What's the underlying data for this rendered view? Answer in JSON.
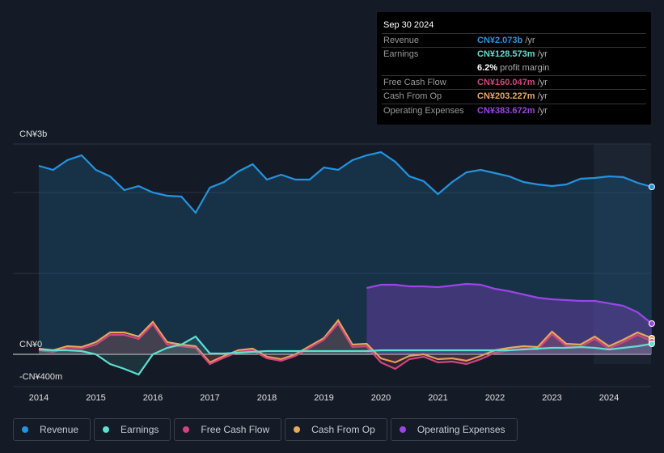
{
  "tooltip": {
    "date": "Sep 30 2024",
    "rows": [
      {
        "label": "Revenue",
        "value": "CN¥2.073b",
        "unit": " /yr",
        "color": "#2394df"
      },
      {
        "label": "Earnings",
        "value": "CN¥128.573m",
        "unit": " /yr",
        "color": "#5ce0d0"
      },
      {
        "label": "",
        "value": "6.2%",
        "unit": " profit margin",
        "color": "#ffffff"
      },
      {
        "label": "Free Cash Flow",
        "value": "CN¥160.047m",
        "unit": " /yr",
        "color": "#d0457f"
      },
      {
        "label": "Cash From Op",
        "value": "CN¥203.227m",
        "unit": " /yr",
        "color": "#e8a95a"
      },
      {
        "label": "Operating Expenses",
        "value": "CN¥383.672m",
        "unit": " /yr",
        "color": "#9b45e4"
      }
    ]
  },
  "chart_data": {
    "type": "area",
    "y_labels": [
      "CN¥3b",
      "CN¥0",
      "-CN¥400m"
    ],
    "x_ticks": [
      "2014",
      "2015",
      "2016",
      "2017",
      "2018",
      "2019",
      "2020",
      "2021",
      "2022",
      "2023",
      "2024"
    ],
    "x_range": [
      2013.55,
      2024.75
    ],
    "units": "CN¥ billions",
    "series": [
      {
        "name": "Revenue",
        "color": "#2394df",
        "x0": 2014,
        "step": 0.25,
        "values": [
          2.33,
          2.28,
          2.4,
          2.46,
          2.28,
          2.2,
          2.03,
          2.08,
          2.0,
          1.96,
          1.95,
          1.75,
          2.06,
          2.13,
          2.26,
          2.35,
          2.16,
          2.22,
          2.16,
          2.16,
          2.31,
          2.28,
          2.4,
          2.46,
          2.5,
          2.38,
          2.2,
          2.14,
          1.98,
          2.13,
          2.25,
          2.28,
          2.24,
          2.2,
          2.13,
          2.1,
          2.08,
          2.1,
          2.17,
          2.18,
          2.2,
          2.19,
          2.12,
          2.07
        ]
      },
      {
        "name": "Earnings",
        "color": "#5ce0d0",
        "x0": 2014,
        "step": 0.25,
        "values": [
          0.06,
          0.05,
          0.05,
          0.04,
          0.0,
          -0.12,
          -0.18,
          -0.25,
          0.0,
          0.08,
          0.12,
          0.22,
          0.01,
          0.01,
          0.02,
          0.03,
          0.04,
          0.04,
          0.04,
          0.04,
          0.04,
          0.04,
          0.04,
          0.04,
          0.05,
          0.05,
          0.05,
          0.05,
          0.05,
          0.05,
          0.05,
          0.05,
          0.05,
          0.05,
          0.06,
          0.07,
          0.08,
          0.08,
          0.09,
          0.08,
          0.06,
          0.08,
          0.1,
          0.13
        ]
      },
      {
        "name": "Free Cash Flow",
        "color": "#d0457f",
        "x0": 2014,
        "step": 0.25,
        "values": [
          0.05,
          0.03,
          0.08,
          0.07,
          0.12,
          0.24,
          0.24,
          0.19,
          0.37,
          0.12,
          0.1,
          0.08,
          -0.12,
          -0.04,
          0.03,
          0.05,
          -0.05,
          -0.08,
          -0.02,
          0.08,
          0.18,
          0.38,
          0.09,
          0.1,
          -0.1,
          -0.18,
          -0.06,
          -0.03,
          -0.1,
          -0.09,
          -0.12,
          -0.06,
          0.02,
          0.05,
          0.07,
          0.06,
          0.25,
          0.1,
          0.09,
          0.19,
          0.07,
          0.15,
          0.24,
          0.16
        ]
      },
      {
        "name": "Cash From Op",
        "color": "#e8a95a",
        "x0": 2014,
        "step": 0.25,
        "values": [
          0.07,
          0.05,
          0.1,
          0.09,
          0.15,
          0.27,
          0.27,
          0.22,
          0.4,
          0.15,
          0.12,
          0.1,
          -0.1,
          -0.02,
          0.05,
          0.07,
          -0.03,
          -0.06,
          0.0,
          0.1,
          0.2,
          0.42,
          0.12,
          0.13,
          -0.05,
          -0.1,
          -0.02,
          0.0,
          -0.06,
          -0.05,
          -0.08,
          -0.02,
          0.05,
          0.08,
          0.1,
          0.09,
          0.28,
          0.13,
          0.12,
          0.22,
          0.1,
          0.18,
          0.27,
          0.2
        ]
      },
      {
        "name": "Operating Expenses",
        "color": "#9b45e4",
        "x0": 2019.75,
        "step": 0.25,
        "values": [
          0.82,
          0.86,
          0.86,
          0.84,
          0.84,
          0.83,
          0.85,
          0.87,
          0.86,
          0.81,
          0.78,
          0.74,
          0.7,
          0.68,
          0.67,
          0.66,
          0.66,
          0.63,
          0.6,
          0.52,
          0.38
        ]
      }
    ]
  }
}
